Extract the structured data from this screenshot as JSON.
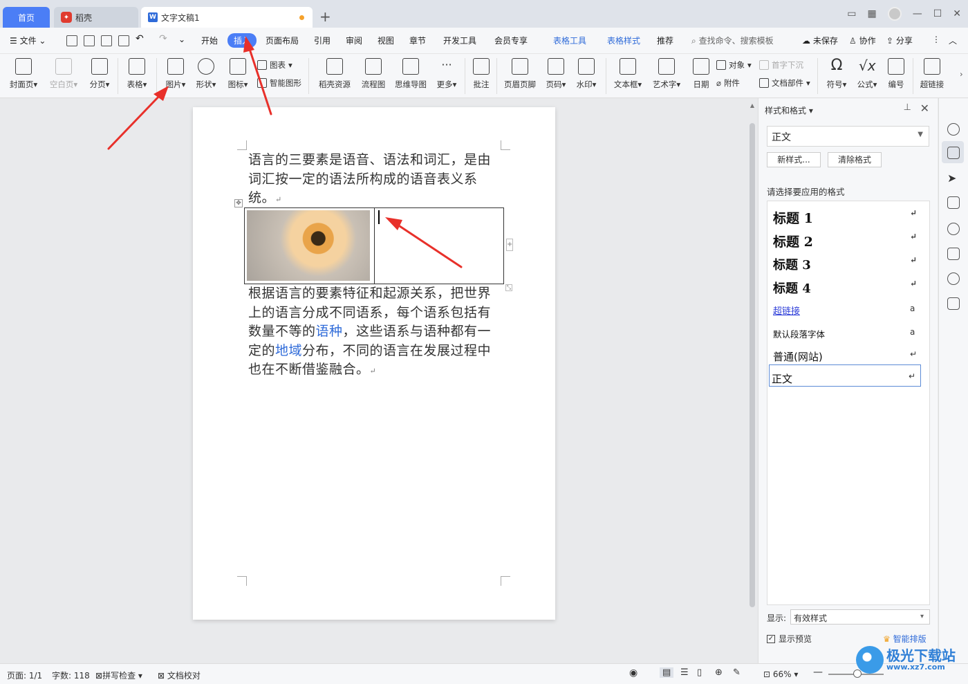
{
  "tabs": {
    "home": "首页",
    "daoke": "稻壳",
    "doc": "文字文稿1"
  },
  "menu": {
    "file": "文件",
    "items": [
      "开始",
      "插入",
      "页面布局",
      "引用",
      "审阅",
      "视图",
      "章节",
      "开发工具",
      "会员专享",
      "表格工具",
      "表格样式",
      "推荐"
    ],
    "active": "插入",
    "search": "查找命令、搜索模板",
    "unsaved": "未保存",
    "collab": "协作",
    "share": "分享"
  },
  "ribbon": {
    "cover": "封面页",
    "blank": "空白页",
    "pagebreak": "分页",
    "table": "表格",
    "picture": "图片",
    "shape": "形状",
    "icon": "图标",
    "chart": "图表",
    "smart": "智能图形",
    "daoke_res": "稻壳资源",
    "flow": "流程图",
    "mindmap": "思维导图",
    "more": "更多",
    "comment": "批注",
    "header": "页眉页脚",
    "pagenum": "页码",
    "watermark": "水印",
    "textbox": "文本框",
    "arttext": "艺术字",
    "date": "日期",
    "object": "对象",
    "dropcap": "首字下沉",
    "attach": "附件",
    "docpart": "文档部件",
    "symbol": "符号",
    "formula": "公式",
    "number": "编号",
    "hyperlink": "超链接"
  },
  "document": {
    "para1": "语言的三要素是语音、语法和词汇，是由词汇按一定的语法所构成的语音表义系统。",
    "para2_a": "根据语言的要素特征和起源关系，把世界上的语言分成不同语系，每个语系包括有数量不等的",
    "para2_link1": "语种",
    "para2_b": "，这些语系与语种都有一定的",
    "para2_link2": "地域",
    "para2_c": "分布，不同的语言在发展过程中也在不断借鉴融合。"
  },
  "panel": {
    "title": "样式和格式",
    "current_style": "正文",
    "new_style": "新样式...",
    "clear_format": "清除格式",
    "label": "请选择要应用的格式",
    "styles": [
      "标题 1",
      "标题 2",
      "标题 3",
      "标题 4",
      "超链接",
      "默认段落字体",
      "普通(网站)",
      "正文"
    ],
    "show_label": "显示:",
    "show_value": "有效样式",
    "preview": "显示预览",
    "smart_layout": "智能排版"
  },
  "status": {
    "page": "页面: 1/1",
    "words": "字数: 118",
    "spell": "拼写检查",
    "proof": "文档校对",
    "zoom": "66%"
  },
  "watermark_site": {
    "name": "极光下载站",
    "url": "www.xz7.com"
  }
}
